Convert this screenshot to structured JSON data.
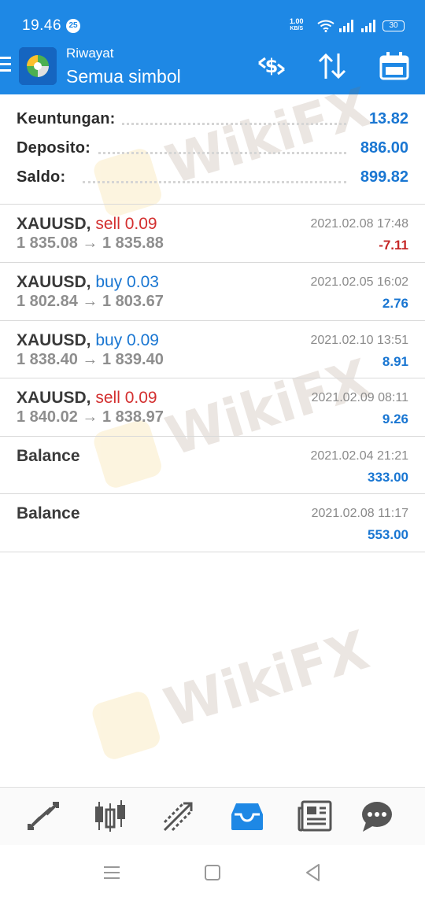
{
  "status_bar": {
    "time": "19.46",
    "notification_count": "25",
    "net_speed_value": "1.00",
    "net_speed_unit": "KB/S",
    "battery": "30"
  },
  "header": {
    "subtitle": "Riwayat",
    "title": "Semua simbol",
    "icons": [
      "menu-icon",
      "app-logo",
      "currency-swap-icon",
      "sort-icon",
      "calendar-icon"
    ]
  },
  "summary": {
    "profit": {
      "label": "Keuntungan:",
      "value": "13.82"
    },
    "deposit": {
      "label": "Deposito:",
      "value": "886.00"
    },
    "balance": {
      "label": "Saldo:",
      "value": "899.82"
    }
  },
  "trades": [
    {
      "symbol": "XAUUSD,",
      "type": "sell 0.09",
      "side": "sell",
      "open": "1 835.08",
      "close": "1 835.88",
      "datetime": "2021.02.08 17:48",
      "profit": "-7.11",
      "sign": "neg"
    },
    {
      "symbol": "XAUUSD,",
      "type": "buy 0.03",
      "side": "buy",
      "open": "1 802.84",
      "close": "1 803.67",
      "datetime": "2021.02.05 16:02",
      "profit": "2.76",
      "sign": "pos"
    },
    {
      "symbol": "XAUUSD,",
      "type": "buy 0.09",
      "side": "buy",
      "open": "1 838.40",
      "close": "1 839.40",
      "datetime": "2021.02.10 13:51",
      "profit": "8.91",
      "sign": "pos"
    },
    {
      "symbol": "XAUUSD,",
      "type": "sell 0.09",
      "side": "sell",
      "open": "1 840.02",
      "close": "1 838.97",
      "datetime": "2021.02.09 08:11",
      "profit": "9.26",
      "sign": "pos"
    }
  ],
  "balances": [
    {
      "label": "Balance",
      "datetime": "2021.02.04 21:21",
      "amount": "333.00"
    },
    {
      "label": "Balance",
      "datetime": "2021.02.08 11:17",
      "amount": "553.00"
    }
  ],
  "arrow": "→",
  "watermark": "WikiFX",
  "bottom_nav": [
    "quotes-icon",
    "chart-icon",
    "trade-icon",
    "history-icon",
    "news-icon",
    "chat-icon"
  ],
  "colors": {
    "header": "#1e88e5",
    "sell": "#d32f2f",
    "buy": "#1976d2",
    "active_nav": "#1e88e5"
  }
}
